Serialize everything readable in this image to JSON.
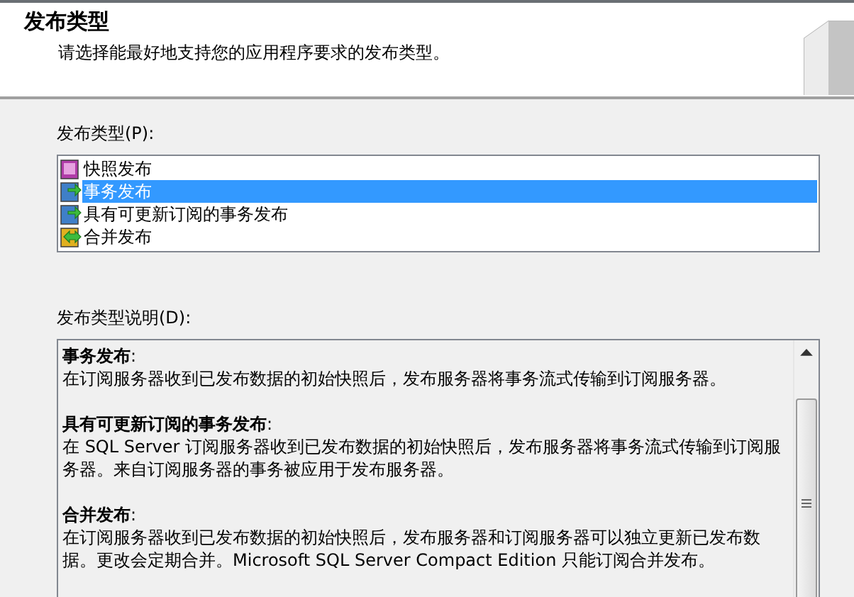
{
  "header": {
    "title": "发布类型",
    "subtitle": "请选择能最好地支持您的应用程序要求的发布类型。"
  },
  "type_list": {
    "label": "发布类型(P):",
    "items": [
      {
        "label": "快照发布",
        "kind": "snapshot",
        "selected": false
      },
      {
        "label": "事务发布",
        "kind": "transactional",
        "selected": true
      },
      {
        "label": "具有可更新订阅的事务发布",
        "kind": "transactional",
        "selected": false
      },
      {
        "label": "合并发布",
        "kind": "merge",
        "selected": false
      }
    ]
  },
  "description": {
    "label": "发布类型说明(D):",
    "paragraphs": [
      {
        "heading": "**事务发布**:",
        "text": "在订阅服务器收到已发布数据的初始快照后，发布服务器将事务流式传输到订阅服务器。"
      },
      {
        "heading": "**具有可更新订阅的事务发布**:",
        "text": "在 SQL Server 订阅服务器收到已发布数据的初始快照后，发布服务器将事务流式传输到订阅服务器。来自订阅服务器的事务被应用于发布服务器。"
      },
      {
        "heading": "**合并发布**:",
        "text": "在订阅服务器收到已发布数据的初始快照后，发布服务器和订阅服务器可以独立更新已发布数据。更改会定期合并。Microsoft SQL Server Compact Edition 只能订阅合并发布。"
      }
    ]
  }
}
